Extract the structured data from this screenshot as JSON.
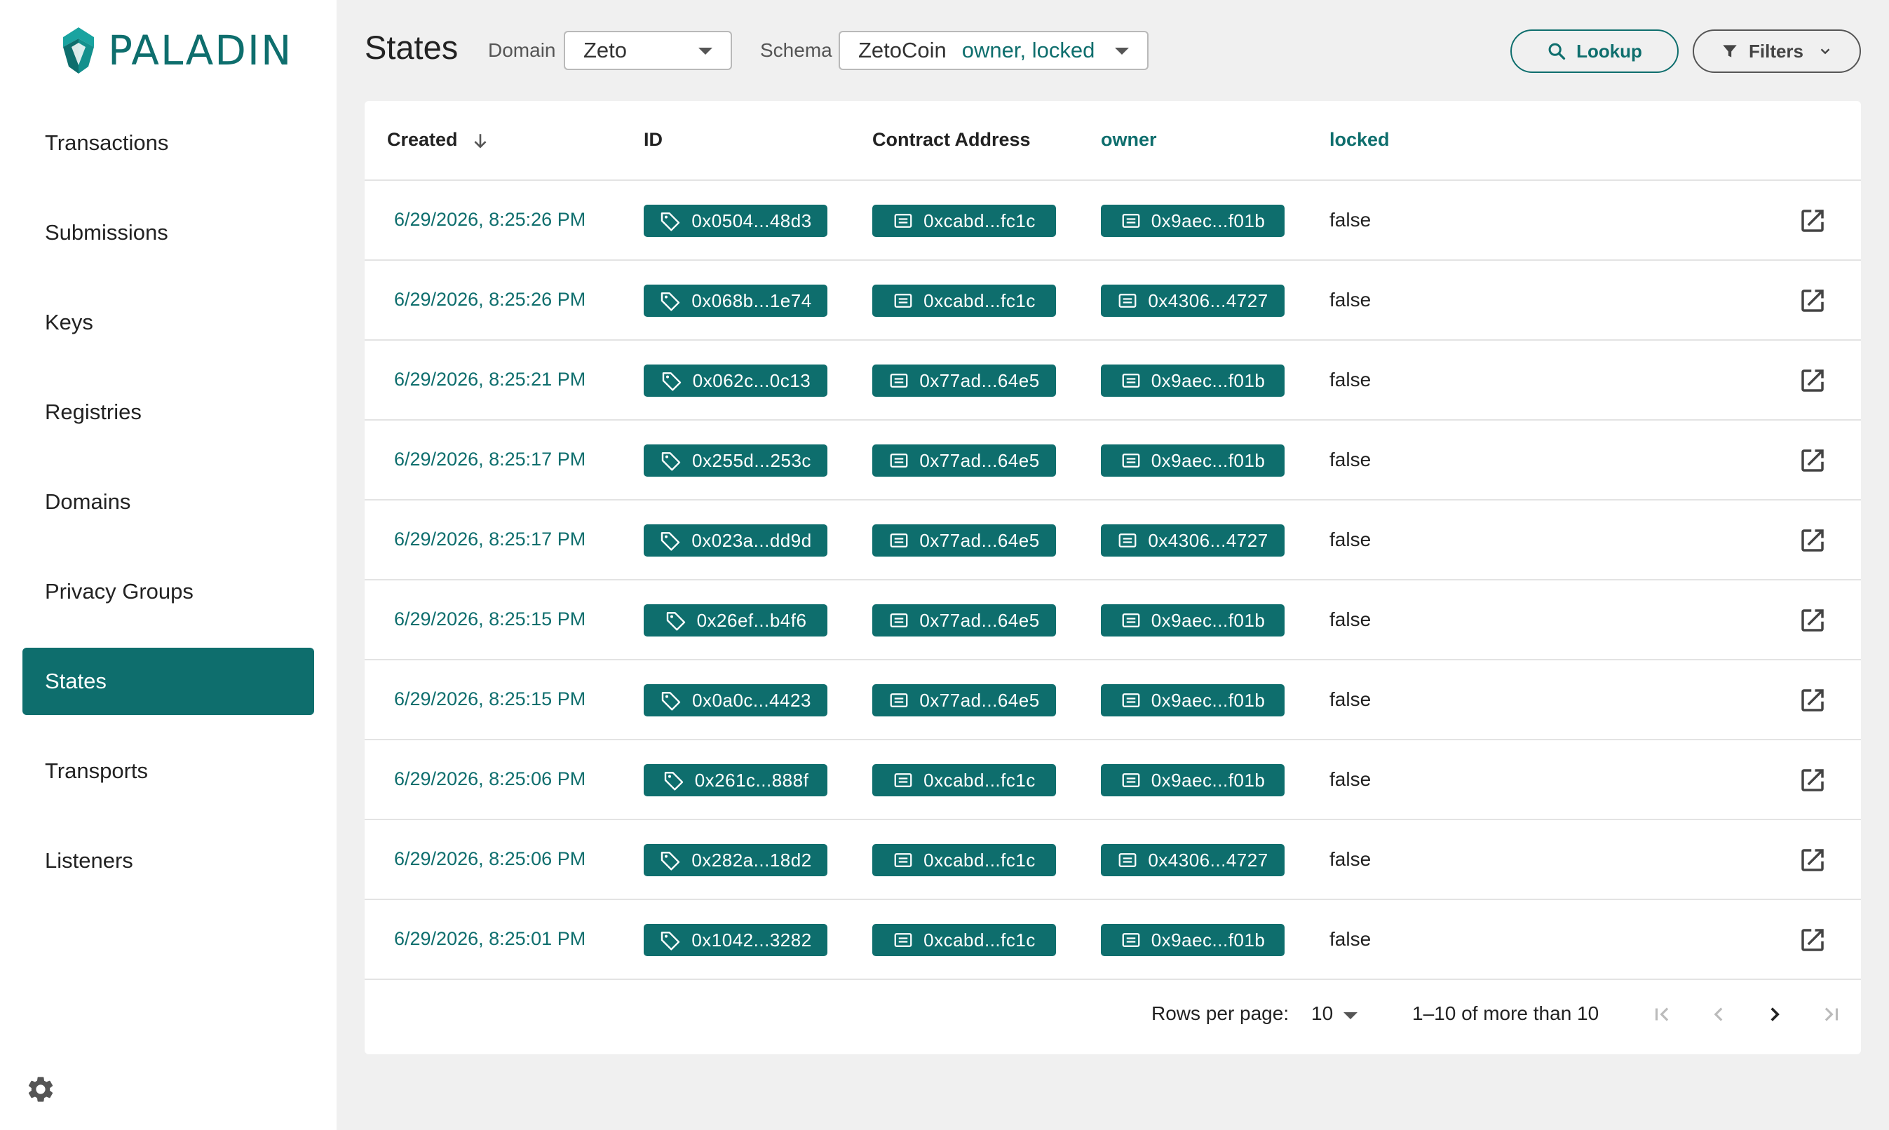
{
  "app": {
    "name": "PALADIN"
  },
  "sidebar": {
    "items": [
      {
        "label": "Transactions",
        "active": false
      },
      {
        "label": "Submissions",
        "active": false
      },
      {
        "label": "Keys",
        "active": false
      },
      {
        "label": "Registries",
        "active": false
      },
      {
        "label": "Domains",
        "active": false
      },
      {
        "label": "Privacy Groups",
        "active": false
      },
      {
        "label": "States",
        "active": true
      },
      {
        "label": "Transports",
        "active": false
      },
      {
        "label": "Listeners",
        "active": false
      }
    ],
    "settings_icon": "gear-icon"
  },
  "header": {
    "title": "States",
    "domain_label": "Domain",
    "domain_value": "Zeto",
    "schema_label": "Schema",
    "schema_value": "ZetoCoin",
    "schema_fields": "owner, locked",
    "lookup_label": "Lookup",
    "filters_label": "Filters"
  },
  "table": {
    "columns": {
      "created": "Created",
      "id": "ID",
      "contract": "Contract Address",
      "owner": "owner",
      "locked": "locked"
    },
    "rows": [
      {
        "created": "6/29/2026, 8:25:26 PM",
        "id": "0x0504...48d3",
        "contract": "0xcabd...fc1c",
        "owner": "0x9aec...f01b",
        "locked": "false"
      },
      {
        "created": "6/29/2026, 8:25:26 PM",
        "id": "0x068b...1e74",
        "contract": "0xcabd...fc1c",
        "owner": "0x4306...4727",
        "locked": "false"
      },
      {
        "created": "6/29/2026, 8:25:21 PM",
        "id": "0x062c...0c13",
        "contract": "0x77ad...64e5",
        "owner": "0x9aec...f01b",
        "locked": "false"
      },
      {
        "created": "6/29/2026, 8:25:17 PM",
        "id": "0x255d...253c",
        "contract": "0x77ad...64e5",
        "owner": "0x9aec...f01b",
        "locked": "false"
      },
      {
        "created": "6/29/2026, 8:25:17 PM",
        "id": "0x023a...dd9d",
        "contract": "0x77ad...64e5",
        "owner": "0x4306...4727",
        "locked": "false"
      },
      {
        "created": "6/29/2026, 8:25:15 PM",
        "id": "0x26ef...b4f6",
        "contract": "0x77ad...64e5",
        "owner": "0x9aec...f01b",
        "locked": "false"
      },
      {
        "created": "6/29/2026, 8:25:15 PM",
        "id": "0x0a0c...4423",
        "contract": "0x77ad...64e5",
        "owner": "0x9aec...f01b",
        "locked": "false"
      },
      {
        "created": "6/29/2026, 8:25:06 PM",
        "id": "0x261c...888f",
        "contract": "0xcabd...fc1c",
        "owner": "0x9aec...f01b",
        "locked": "false"
      },
      {
        "created": "6/29/2026, 8:25:06 PM",
        "id": "0x282a...18d2",
        "contract": "0xcabd...fc1c",
        "owner": "0x4306...4727",
        "locked": "false"
      },
      {
        "created": "6/29/2026, 8:25:01 PM",
        "id": "0x1042...3282",
        "contract": "0xcabd...fc1c",
        "owner": "0x9aec...f01b",
        "locked": "false"
      }
    ]
  },
  "pagination": {
    "rows_per_page_label": "Rows per page:",
    "rows_per_page_value": "10",
    "range_text": "1–10 of more than 10"
  },
  "colors": {
    "accent": "#0e6e6d",
    "background": "#f0f0f0",
    "surface": "#ffffff"
  }
}
